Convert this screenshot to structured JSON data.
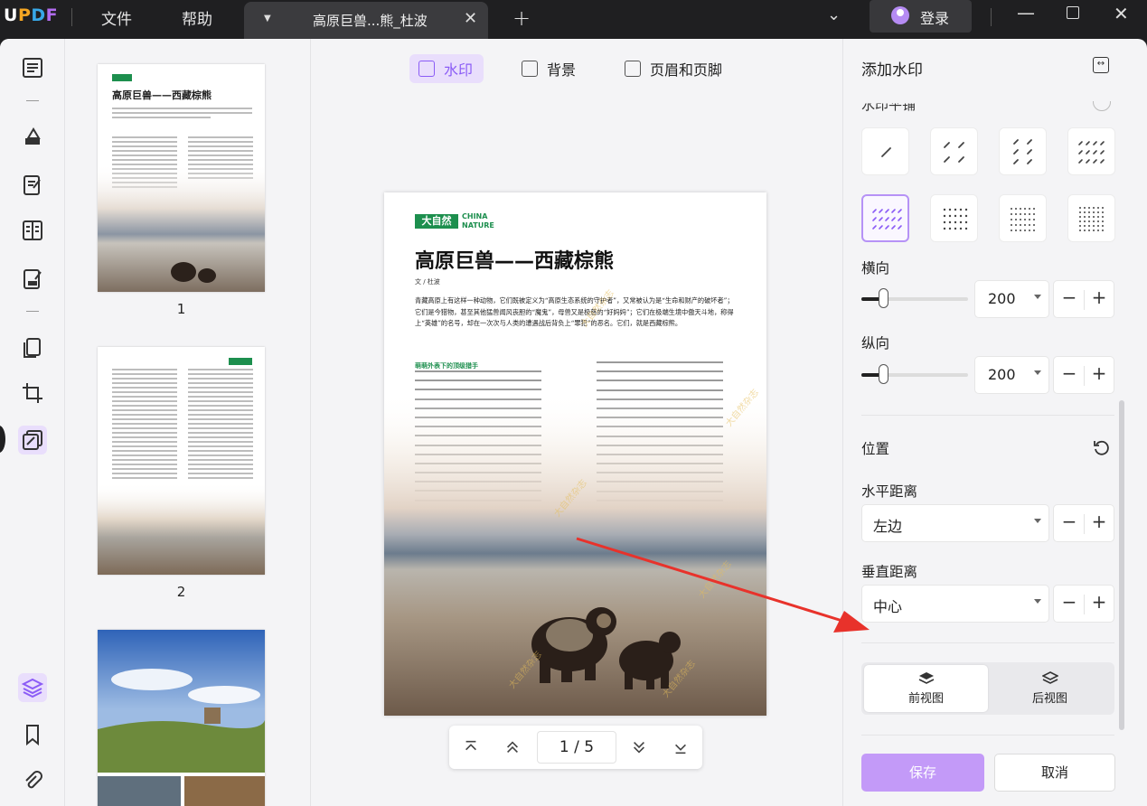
{
  "app": {
    "logo": "UPDF"
  },
  "menu": {
    "file": "文件",
    "help": "帮助"
  },
  "tab": {
    "title": "高原巨兽...熊_杜波",
    "close": "✕",
    "add": "+"
  },
  "window": {
    "login": "登录"
  },
  "thumbnails": {
    "items": [
      {
        "number": "1",
        "title": "高原巨兽——西藏棕熊"
      },
      {
        "number": "2"
      }
    ]
  },
  "toolbar": {
    "watermark": "水印",
    "background": "背景",
    "header_footer": "页眉和页脚"
  },
  "document": {
    "logo_box": "大自然",
    "logo_text_1": "CHINA",
    "logo_text_2": "NATURE",
    "title": "高原巨兽——西藏棕熊",
    "author": "文 / 杜波",
    "intro": "青藏高原上有这样一种动物，它们既被定义为“高原生态系统的守护者”，又常被认为是“生命和财产的破坏者”；它们是今猎物，甚至其他猛兽闻风丧胆的“魔鬼”，母兽又是极慈的“好妈妈”；它们在极端生境中傲天斗地，称得上“英雄”的名号，却在一次次与人类的遭遇战后背负上“罪犯”的恶名。它们，就是西藏棕熊。",
    "subheading": "萌萌外表下的顶级猎手",
    "watermark_text": "大自然杂志"
  },
  "navigation": {
    "page_indicator": "1 / 5"
  },
  "panel": {
    "title": "添加水印",
    "cut_label": "水印平铺",
    "horizontal_label": "横向",
    "horizontal_value": "200",
    "vertical_label": "纵向",
    "vertical_value": "200",
    "slider_level_fraction": 0.2,
    "position_label": "位置",
    "h_distance_label": "水平距离",
    "h_distance_value": "左边",
    "v_distance_label": "垂直距离",
    "v_distance_value": "中心",
    "front_view": "前视图",
    "back_view": "后视图",
    "save": "保存",
    "cancel": "取消"
  },
  "colors": {
    "accent": "#8b5cf6",
    "accent_light": "#e9defc",
    "save_button": "#c39af8",
    "arrow": "#e8322b",
    "brand_green": "#1d8f4e"
  }
}
